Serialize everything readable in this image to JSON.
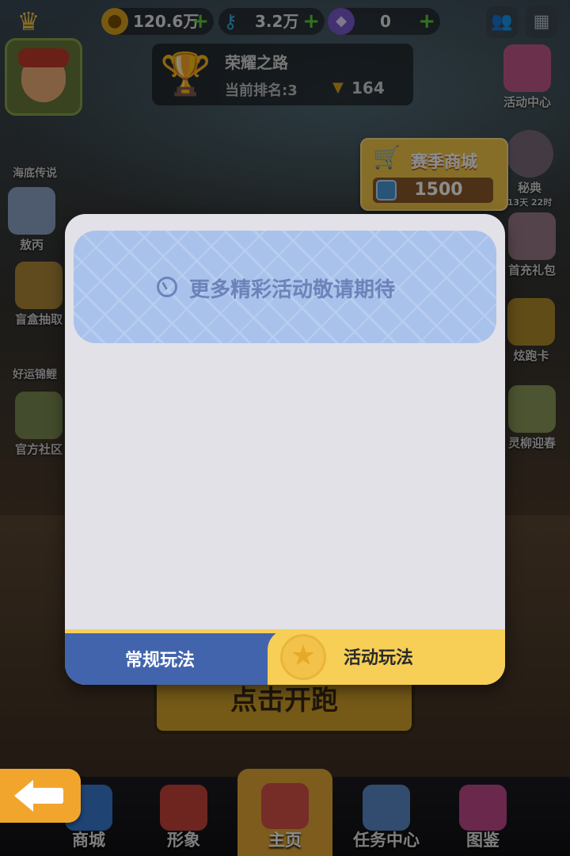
{
  "topbar": {
    "coins": "120.6万",
    "keys": "3.2万",
    "gems": "0"
  },
  "rank_panel": {
    "title": "荣耀之路",
    "current_rank": "当前排名:3",
    "trophies": "164"
  },
  "left_side": {
    "legend": "海底传说",
    "item1": "敖丙",
    "item2": "盲盒抽取",
    "lucky": "好运锦鲤",
    "item3": "官方社区"
  },
  "right_side": {
    "activity_center": "活动中心",
    "secret": "秘典",
    "secret_timer": "13天 22时",
    "first_charge": "首充礼包",
    "run_card": "炫跑卡",
    "spring": "灵柳迎春"
  },
  "season_shop": {
    "label": "赛季商城",
    "amount": "1500"
  },
  "start_button": "点击开跑",
  "modal": {
    "banner_text": "更多精彩活动敬请期待",
    "tab_normal": "常规玩法",
    "tab_event": "活动玩法",
    "active_tab": "活动玩法"
  },
  "bottom_nav": {
    "shop": "商城",
    "avatar": "形象",
    "home": "主页",
    "tasks": "任务中心",
    "codex": "图鉴",
    "active": "主页"
  },
  "colors": {
    "modal_bg": "#e2e1e8",
    "banner": "#a9c2ec",
    "tab_normal": "#4264ad",
    "tab_event": "#f7cf57",
    "back_button": "#f2a52c"
  }
}
